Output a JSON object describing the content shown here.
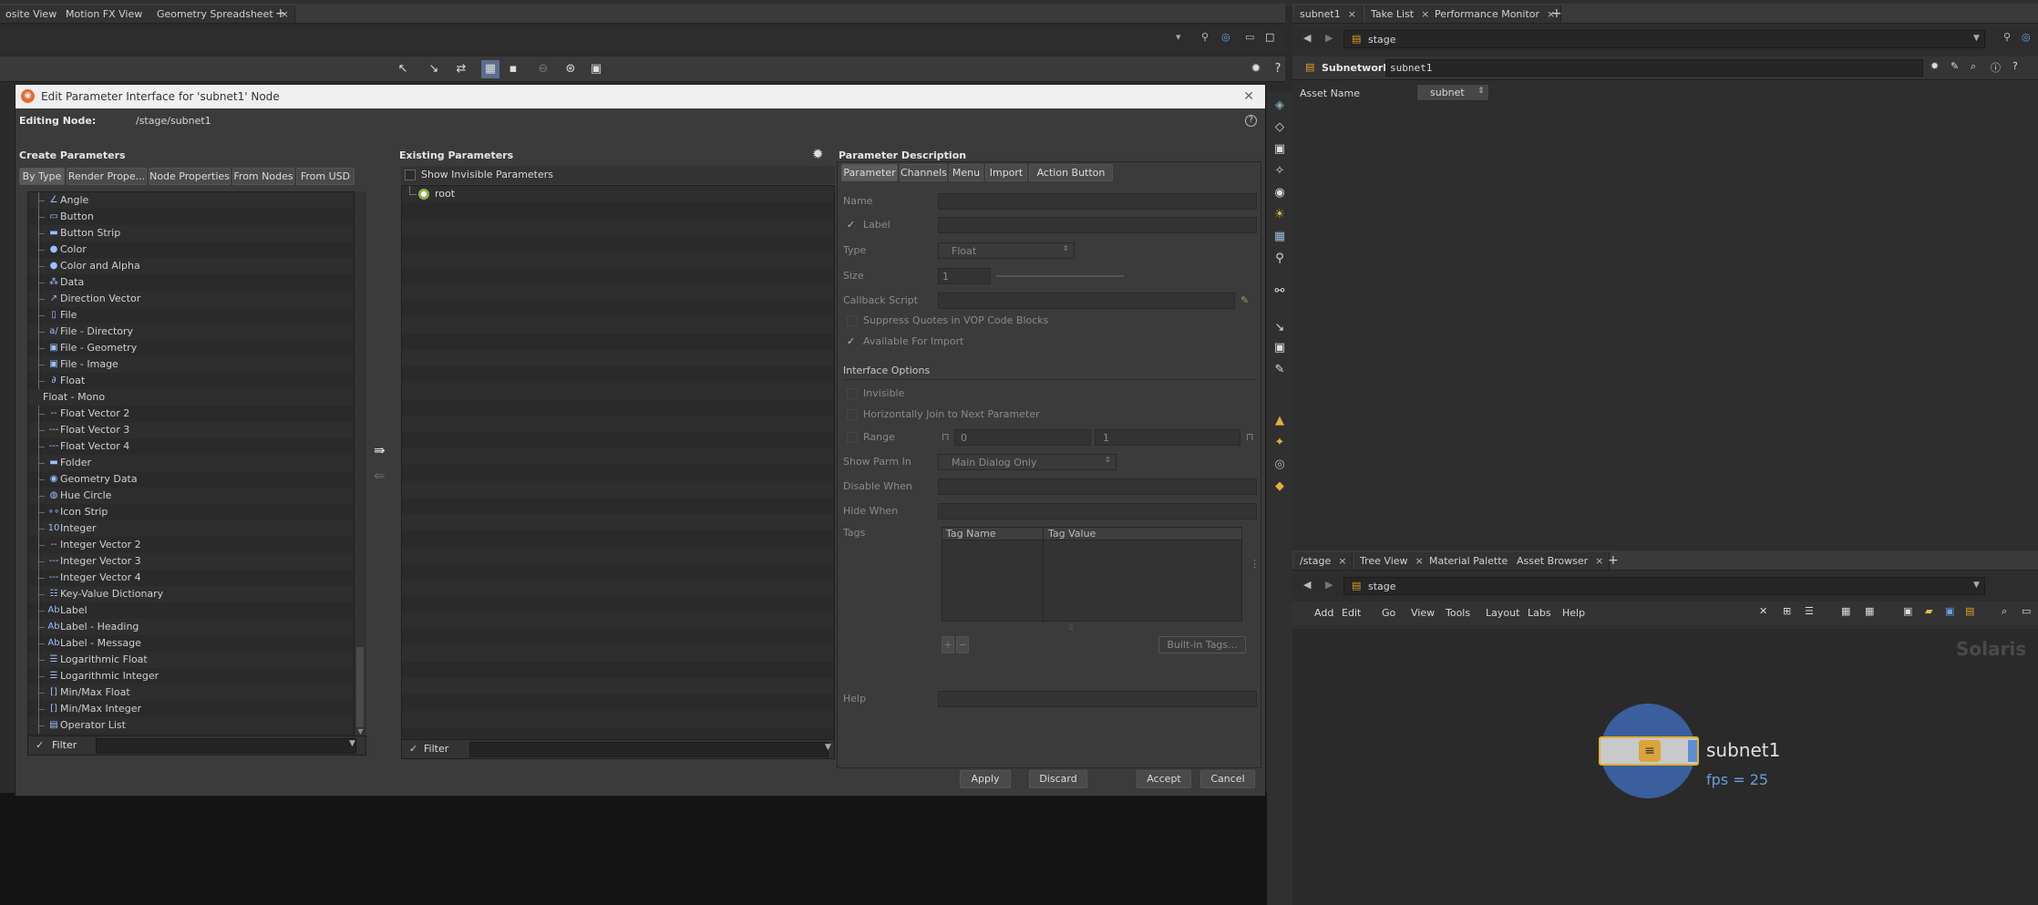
{
  "left_tabs": [
    {
      "label": "osite View"
    },
    {
      "label": "Motion FX View"
    },
    {
      "label": "Geometry Spreadsheet"
    }
  ],
  "right_top_tabs": [
    {
      "label": "subnet1"
    },
    {
      "label": "Take List"
    },
    {
      "label": "Performance Monitor"
    }
  ],
  "right_top_path": "stage",
  "network_header": {
    "type_label": "Subnetwork",
    "name_value": "subnet1"
  },
  "asset_name": {
    "label": "Asset Name",
    "value": "subnet"
  },
  "dialog": {
    "title": "Edit Parameter Interface for 'subnet1' Node",
    "editing_node_label": "Editing Node:",
    "editing_node_value": "/stage/subnet1",
    "create_params": {
      "title": "Create Parameters",
      "tabs": [
        "By Type",
        "Render Prope...",
        "Node Properties",
        "From Nodes",
        "From USD"
      ],
      "items": [
        {
          "label": "Angle",
          "icon": "angle-icon",
          "glyph": "∠"
        },
        {
          "label": "Button",
          "icon": "button-icon",
          "glyph": "▭"
        },
        {
          "label": "Button Strip",
          "icon": "button-strip-icon",
          "glyph": "▬"
        },
        {
          "label": "Color",
          "icon": "color-icon",
          "glyph": "●"
        },
        {
          "label": "Color and Alpha",
          "icon": "color-alpha-icon",
          "glyph": "●"
        },
        {
          "label": "Data",
          "icon": "data-icon",
          "glyph": "⁂"
        },
        {
          "label": "Direction Vector",
          "icon": "direction-vector-icon",
          "glyph": "↗"
        },
        {
          "label": "File",
          "icon": "file-icon",
          "glyph": "▯"
        },
        {
          "label": "File - Directory",
          "icon": "file-directory-icon",
          "glyph": "a/"
        },
        {
          "label": "File - Geometry",
          "icon": "file-geometry-icon",
          "glyph": "▣"
        },
        {
          "label": "File - Image",
          "icon": "file-image-icon",
          "glyph": "▣"
        },
        {
          "label": "Float",
          "icon": "float-icon",
          "glyph": "∂"
        },
        {
          "label": "Float - Mono",
          "icon": "",
          "glyph": ""
        },
        {
          "label": "Float Vector 2",
          "icon": "float-vector2-icon",
          "glyph": "--"
        },
        {
          "label": "Float Vector 3",
          "icon": "float-vector3-icon",
          "glyph": "---"
        },
        {
          "label": "Float Vector 4",
          "icon": "float-vector4-icon",
          "glyph": "----"
        },
        {
          "label": "Folder",
          "icon": "folder-icon",
          "glyph": "▬"
        },
        {
          "label": "Geometry Data",
          "icon": "geometry-data-icon",
          "glyph": "◉"
        },
        {
          "label": "Hue Circle",
          "icon": "hue-circle-icon",
          "glyph": "◍"
        },
        {
          "label": "Icon Strip",
          "icon": "icon-strip-icon",
          "glyph": "∘∘"
        },
        {
          "label": "Integer",
          "icon": "integer-icon",
          "glyph": "10"
        },
        {
          "label": "Integer Vector 2",
          "icon": "integer-vector2-icon",
          "glyph": "--"
        },
        {
          "label": "Integer Vector 3",
          "icon": "integer-vector3-icon",
          "glyph": "---"
        },
        {
          "label": "Integer Vector 4",
          "icon": "integer-vector4-icon",
          "glyph": "----"
        },
        {
          "label": "Key-Value Dictionary",
          "icon": "key-value-icon",
          "glyph": "☷"
        },
        {
          "label": "Label",
          "icon": "label-icon",
          "glyph": "Ab"
        },
        {
          "label": "Label - Heading",
          "icon": "label-heading-icon",
          "glyph": "Ab"
        },
        {
          "label": "Label - Message",
          "icon": "label-message-icon",
          "glyph": "Ab"
        },
        {
          "label": "Logarithmic Float",
          "icon": "log-float-icon",
          "glyph": "☰"
        },
        {
          "label": "Logarithmic Integer",
          "icon": "log-integer-icon",
          "glyph": "☰"
        },
        {
          "label": "Min/Max Float",
          "icon": "minmax-float-icon",
          "glyph": "[]"
        },
        {
          "label": "Min/Max Integer",
          "icon": "minmax-integer-icon",
          "glyph": "[]"
        },
        {
          "label": "Operator List",
          "icon": "operator-list-icon",
          "glyph": "▤"
        }
      ],
      "filter_label": "Filter"
    },
    "existing_params": {
      "title": "Existing Parameters",
      "show_invisible_label": "Show Invisible Parameters",
      "root_label": "root",
      "filter_label": "Filter"
    },
    "param_desc": {
      "title": "Parameter Description",
      "tabs": [
        "Parameter",
        "Channels",
        "Menu",
        "Import",
        "Action Button"
      ],
      "name_label": "Name",
      "label_label": "Label",
      "type_label": "Type",
      "type_value": "Float",
      "size_label": "Size",
      "size_value": "1",
      "callback_label": "Callback Script",
      "suppress_label": "Suppress Quotes in VOP Code Blocks",
      "available_label": "Available For Import",
      "interface_options_label": "Interface Options",
      "invisible_label": "Invisible",
      "hjoin_label": "Horizontally Join to Next Parameter",
      "range_label": "Range",
      "range_min": "0",
      "range_max": "1",
      "show_parm_label": "Show Parm In",
      "show_parm_value": "Main Dialog Only",
      "disable_when_label": "Disable When",
      "hide_when_label": "Hide When",
      "tags_label": "Tags",
      "tag_name_header": "Tag Name",
      "tag_value_header": "Tag Value",
      "builtin_tags_label": "Built-in Tags...",
      "help_label": "Help"
    },
    "buttons": {
      "apply": "Apply",
      "discard": "Discard",
      "accept": "Accept",
      "cancel": "Cancel"
    }
  },
  "network_tabs": [
    {
      "label": "/stage"
    },
    {
      "label": "Tree View"
    },
    {
      "label": "Material Palette"
    },
    {
      "label": "Asset Browser"
    }
  ],
  "network_path": "stage",
  "network_menu": [
    "Add",
    "Edit",
    "Go",
    "View",
    "Tools",
    "Layout",
    "Labs",
    "Help"
  ],
  "network_context_label": "Solaris",
  "node": {
    "name": "subnet1",
    "fps": "fps = 25"
  },
  "colors": {
    "accent": "#e0a020",
    "node_blue": "#3a5f9c",
    "fps_text": "#6a9fd8"
  }
}
